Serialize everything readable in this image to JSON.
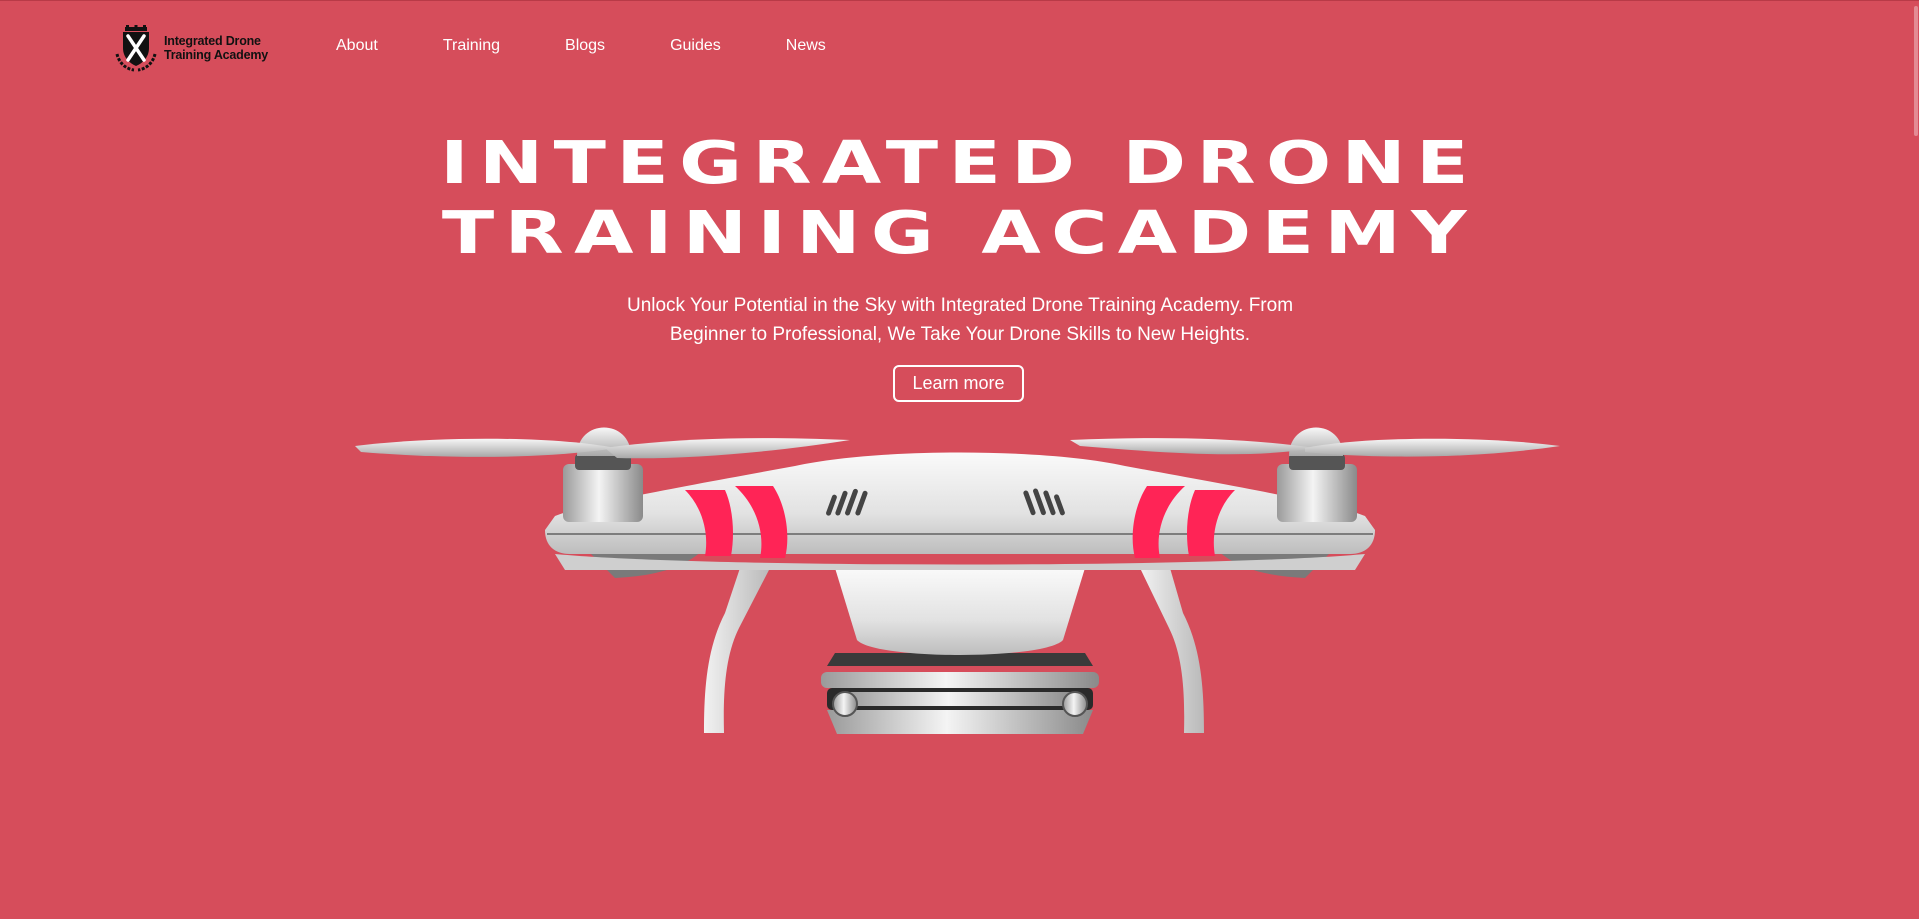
{
  "logo": {
    "line1": "Integrated Drone",
    "line2": "Training Academy"
  },
  "nav": {
    "items": [
      "About",
      "Training",
      "Blogs",
      "Guides",
      "News"
    ]
  },
  "hero": {
    "title_line1": "INTEGRATED DRONE",
    "title_line2": "TRAINING ACADEMY",
    "subtitle_line1": "Unlock Your Potential in the Sky with Integrated Drone Training Academy. From",
    "subtitle_line2": "Beginner to Professional, We Take Your Drone Skills to New Heights.",
    "cta_label": "Learn more"
  },
  "colors": {
    "background": "#d64d5b",
    "drone_body": "#eeeeee",
    "drone_accent": "#ff2456"
  },
  "icons": [
    "crest-logo-icon",
    "drone-illustration"
  ]
}
